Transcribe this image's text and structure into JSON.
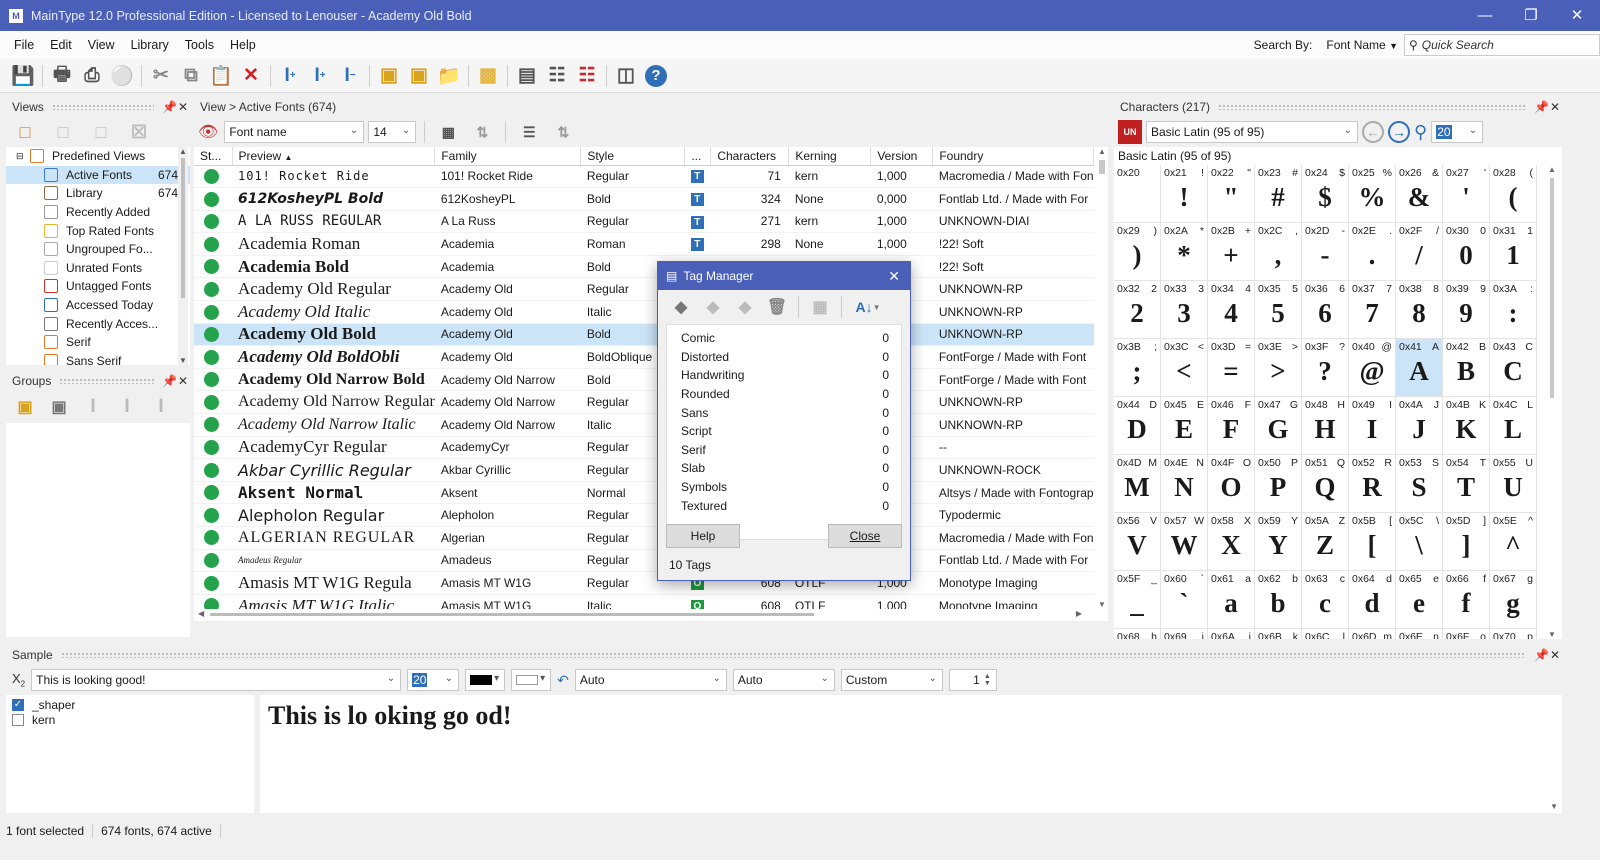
{
  "window": {
    "title": "MainType 12.0 Professional Edition - Licensed to Lenouser - Academy Old Bold"
  },
  "menu": [
    "File",
    "Edit",
    "View",
    "Library",
    "Tools",
    "Help"
  ],
  "search": {
    "label": "Search By:",
    "mode": "Font Name",
    "placeholder": "Quick Search"
  },
  "toolbar_icons": [
    "save-icon",
    "print-preview-icon",
    "print-icon",
    "web-icon",
    "cut-icon",
    "copy-icon",
    "paste-icon",
    "delete-icon",
    "install-font-icon",
    "add-font-icon",
    "uninstall-font-icon",
    "tag-icon",
    "add-tag-icon",
    "folder-icon",
    "package-icon",
    "export-icon",
    "report-icon",
    "remove-report-icon",
    "window-icon",
    "help-icon"
  ],
  "views": {
    "title": "Views",
    "root": "Predefined Views",
    "items": [
      {
        "label": "Active Fonts",
        "count": "674",
        "selected": true
      },
      {
        "label": "Library",
        "count": "674"
      },
      {
        "label": "Recently Added",
        "count": ""
      },
      {
        "label": "Top Rated Fonts",
        "count": ""
      },
      {
        "label": "Ungrouped Fo...",
        "count": ""
      },
      {
        "label": "Unrated Fonts",
        "count": ""
      },
      {
        "label": "Untagged Fonts",
        "count": ""
      },
      {
        "label": "Accessed Today",
        "count": ""
      },
      {
        "label": "Recently Acces...",
        "count": ""
      },
      {
        "label": "Serif",
        "count": ""
      },
      {
        "label": "Sans Serif",
        "count": ""
      }
    ]
  },
  "groups": {
    "title": "Groups"
  },
  "fontlist": {
    "breadcrumb": "View > Active Fonts (674)",
    "preview_type": "Font name",
    "preview_size": "14",
    "columns": [
      "St...",
      "Preview",
      "Family",
      "Style",
      "...",
      "Characters",
      "Kerning",
      "Version",
      "Foundry"
    ],
    "rows": [
      {
        "preview": "101! Rocket Ride",
        "family": "101! Rocket Ride",
        "style": "Regular",
        "type": "T",
        "chars": "71",
        "kerning": "kern",
        "version": "1,000",
        "foundry": "Macromedia / Made with Fon"
      },
      {
        "preview": "612KosheyPL Bold",
        "family": "612KosheyPL",
        "style": "Bold",
        "type": "T",
        "chars": "324",
        "kerning": "None",
        "version": "0,000",
        "foundry": "Fontlab Ltd. / Made with For"
      },
      {
        "preview": "A LA RUSS REGULAR",
        "family": "A La Russ",
        "style": "Regular",
        "type": "T",
        "chars": "271",
        "kerning": "kern",
        "version": "1,000",
        "foundry": "UNKNOWN-DIAI"
      },
      {
        "preview": "Academia Roman",
        "family": "Academia",
        "style": "Roman",
        "type": "T",
        "chars": "298",
        "kerning": "None",
        "version": "1,000",
        "foundry": "!22! Soft"
      },
      {
        "preview": "Academia Bold",
        "family": "Academia",
        "style": "Bold",
        "type": "",
        "chars": "",
        "kerning": "",
        "version": "",
        "foundry": "!22! Soft"
      },
      {
        "preview": "Academy Old Regular",
        "family": "Academy Old",
        "style": "Regular",
        "type": "",
        "chars": "",
        "kerning": "",
        "version": "",
        "foundry": "UNKNOWN-RP"
      },
      {
        "preview": "Academy Old Italic",
        "family": "Academy Old",
        "style": "Italic",
        "type": "",
        "chars": "",
        "kerning": "",
        "version": "",
        "foundry": "UNKNOWN-RP"
      },
      {
        "preview": "Academy Old Bold",
        "family": "Academy Old",
        "style": "Bold",
        "type": "",
        "chars": "",
        "kerning": "",
        "version": "",
        "foundry": "UNKNOWN-RP",
        "selected": true
      },
      {
        "preview": "Academy Old BoldObli",
        "family": "Academy Old",
        "style": "BoldOblique",
        "type": "",
        "chars": "",
        "kerning": "",
        "version": "",
        "foundry": "FontForge / Made with  Font"
      },
      {
        "preview": "Academy Old Narrow Bold",
        "family": "Academy Old Narrow",
        "style": "Bold",
        "type": "",
        "chars": "",
        "kerning": "",
        "version": "",
        "foundry": "FontForge / Made with  Font"
      },
      {
        "preview": "Academy Old Narrow Regular",
        "family": "Academy Old Narrow",
        "style": "Regular",
        "type": "",
        "chars": "",
        "kerning": "",
        "version": "",
        "foundry": "UNKNOWN-RP"
      },
      {
        "preview": "Academy Old Narrow Italic",
        "family": "Academy Old Narrow",
        "style": "Italic",
        "type": "",
        "chars": "",
        "kerning": "",
        "version": "",
        "foundry": "UNKNOWN-RP"
      },
      {
        "preview": "AcademyCyr Regular",
        "family": "AcademyCyr",
        "style": "Regular",
        "type": "",
        "chars": "",
        "kerning": "",
        "version": "",
        "foundry": "--"
      },
      {
        "preview": "Akbar Cyrillic Regular",
        "family": "Akbar Cyrillic",
        "style": "Regular",
        "type": "",
        "chars": "",
        "kerning": "",
        "version": "",
        "foundry": "UNKNOWN-ROCK"
      },
      {
        "preview": "Aksent Normal",
        "family": "Aksent",
        "style": "Normal",
        "type": "",
        "chars": "",
        "kerning": "",
        "version": "",
        "foundry": "Altsys / Made with Fontograp"
      },
      {
        "preview": "Alepholon Regular",
        "family": "Alepholon",
        "style": "Regular",
        "type": "",
        "chars": "",
        "kerning": "",
        "version": "",
        "foundry": "Typodermic"
      },
      {
        "preview": "ALGERIAN REGULAR",
        "family": "Algerian",
        "style": "Regular",
        "type": "",
        "chars": "",
        "kerning": "",
        "version": "",
        "foundry": "Macromedia / Made with Fon"
      },
      {
        "preview": "Amadeus Regular",
        "family": "Amadeus",
        "style": "Regular",
        "type": "",
        "chars": "",
        "kerning": "",
        "version": "",
        "foundry": "Fontlab Ltd. / Made with For"
      },
      {
        "preview": "Amasis MT W1G Regula",
        "family": "Amasis MT W1G",
        "style": "Regular",
        "type": "O",
        "chars": "608",
        "kerning": "OTLF",
        "version": "1,000",
        "foundry": "Monotype Imaging"
      },
      {
        "preview": "Amasis MT W1G Italic",
        "family": "Amasis MT W1G",
        "style": "Italic",
        "type": "O",
        "chars": "608",
        "kerning": "OTLF",
        "version": "1,000",
        "foundry": "Monotype Imaging"
      }
    ]
  },
  "characters": {
    "title": "Characters (217)",
    "range": "Basic Latin (95 of 95)",
    "size": "20",
    "section": "Basic Latin (95 of 95)",
    "cells": [
      {
        "code": "0x20",
        "ch": " "
      },
      {
        "code": "0x21",
        "ch": "!"
      },
      {
        "code": "0x22",
        "ch": "\""
      },
      {
        "code": "0x23",
        "ch": "#"
      },
      {
        "code": "0x24",
        "ch": "$"
      },
      {
        "code": "0x25",
        "ch": "%"
      },
      {
        "code": "0x26",
        "ch": "&"
      },
      {
        "code": "0x27",
        "ch": "'"
      },
      {
        "code": "0x28",
        "ch": "("
      },
      {
        "code": "0x29",
        "ch": ")"
      },
      {
        "code": "0x2A",
        "ch": "*"
      },
      {
        "code": "0x2B",
        "ch": "+"
      },
      {
        "code": "0x2C",
        "ch": ","
      },
      {
        "code": "0x2D",
        "ch": "-"
      },
      {
        "code": "0x2E",
        "ch": "."
      },
      {
        "code": "0x2F",
        "ch": "/"
      },
      {
        "code": "0x30",
        "ch": "0"
      },
      {
        "code": "0x31",
        "ch": "1"
      },
      {
        "code": "0x32",
        "ch": "2"
      },
      {
        "code": "0x33",
        "ch": "3"
      },
      {
        "code": "0x34",
        "ch": "4"
      },
      {
        "code": "0x35",
        "ch": "5"
      },
      {
        "code": "0x36",
        "ch": "6"
      },
      {
        "code": "0x37",
        "ch": "7"
      },
      {
        "code": "0x38",
        "ch": "8"
      },
      {
        "code": "0x39",
        "ch": "9"
      },
      {
        "code": "0x3A",
        "ch": ":"
      },
      {
        "code": "0x3B",
        "ch": ";"
      },
      {
        "code": "0x3C",
        "ch": "<"
      },
      {
        "code": "0x3D",
        "ch": "="
      },
      {
        "code": "0x3E",
        "ch": ">"
      },
      {
        "code": "0x3F",
        "ch": "?"
      },
      {
        "code": "0x40",
        "ch": "@"
      },
      {
        "code": "0x41",
        "ch": "A",
        "selected": true
      },
      {
        "code": "0x42",
        "ch": "B"
      },
      {
        "code": "0x43",
        "ch": "C"
      },
      {
        "code": "0x44",
        "ch": "D"
      },
      {
        "code": "0x45",
        "ch": "E"
      },
      {
        "code": "0x46",
        "ch": "F"
      },
      {
        "code": "0x47",
        "ch": "G"
      },
      {
        "code": "0x48",
        "ch": "H"
      },
      {
        "code": "0x49",
        "ch": "I"
      },
      {
        "code": "0x4A",
        "ch": "J"
      },
      {
        "code": "0x4B",
        "ch": "K"
      },
      {
        "code": "0x4C",
        "ch": "L"
      },
      {
        "code": "0x4D",
        "ch": "M"
      },
      {
        "code": "0x4E",
        "ch": "N"
      },
      {
        "code": "0x4F",
        "ch": "O"
      },
      {
        "code": "0x50",
        "ch": "P"
      },
      {
        "code": "0x51",
        "ch": "Q"
      },
      {
        "code": "0x52",
        "ch": "R"
      },
      {
        "code": "0x53",
        "ch": "S"
      },
      {
        "code": "0x54",
        "ch": "T"
      },
      {
        "code": "0x55",
        "ch": "U"
      },
      {
        "code": "0x56",
        "ch": "V"
      },
      {
        "code": "0x57",
        "ch": "W"
      },
      {
        "code": "0x58",
        "ch": "X"
      },
      {
        "code": "0x59",
        "ch": "Y"
      },
      {
        "code": "0x5A",
        "ch": "Z"
      },
      {
        "code": "0x5B",
        "ch": "["
      },
      {
        "code": "0x5C",
        "ch": "\\"
      },
      {
        "code": "0x5D",
        "ch": "]"
      },
      {
        "code": "0x5E",
        "ch": "^"
      },
      {
        "code": "0x5F",
        "ch": "_"
      },
      {
        "code": "0x60",
        "ch": "`"
      },
      {
        "code": "0x61",
        "ch": "a"
      },
      {
        "code": "0x62",
        "ch": "b"
      },
      {
        "code": "0x63",
        "ch": "c"
      },
      {
        "code": "0x64",
        "ch": "d"
      },
      {
        "code": "0x65",
        "ch": "e"
      },
      {
        "code": "0x66",
        "ch": "f"
      },
      {
        "code": "0x67",
        "ch": "g"
      },
      {
        "code": "0x68",
        "ch": "h"
      },
      {
        "code": "0x69",
        "ch": "i"
      },
      {
        "code": "0x6A",
        "ch": "j"
      },
      {
        "code": "0x6B",
        "ch": "k"
      },
      {
        "code": "0x6C",
        "ch": "l"
      },
      {
        "code": "0x6D",
        "ch": "m"
      },
      {
        "code": "0x6E",
        "ch": "n"
      },
      {
        "code": "0x6F",
        "ch": "o"
      },
      {
        "code": "0x70",
        "ch": "p"
      }
    ]
  },
  "tag_manager": {
    "title": "Tag Manager",
    "tags": [
      {
        "name": "Comic",
        "count": "0"
      },
      {
        "name": "Distorted",
        "count": "0"
      },
      {
        "name": "Handwriting",
        "count": "0"
      },
      {
        "name": "Rounded",
        "count": "0"
      },
      {
        "name": "Sans",
        "count": "0"
      },
      {
        "name": "Script",
        "count": "0"
      },
      {
        "name": "Serif",
        "count": "0"
      },
      {
        "name": "Slab",
        "count": "0"
      },
      {
        "name": "Symbols",
        "count": "0"
      },
      {
        "name": "Textured",
        "count": "0"
      }
    ],
    "help": "Help",
    "close": "Close",
    "footer": "10 Tags"
  },
  "sample": {
    "title": "Sample",
    "text": "This is looking good!",
    "size": "20",
    "script": "Auto",
    "language": "Auto",
    "features": "Custom",
    "spin": "1",
    "options": [
      {
        "label": "_shaper",
        "checked": true
      },
      {
        "label": "kern",
        "checked": false
      }
    ],
    "preview": "This is lo oking go od!"
  },
  "status": {
    "selected": "1 font selected",
    "totals": "674 fonts, 674 active"
  },
  "colors": {
    "titlebar": "#4a60b8",
    "selection": "#cce4f7",
    "active_dot": "#24a34c"
  }
}
